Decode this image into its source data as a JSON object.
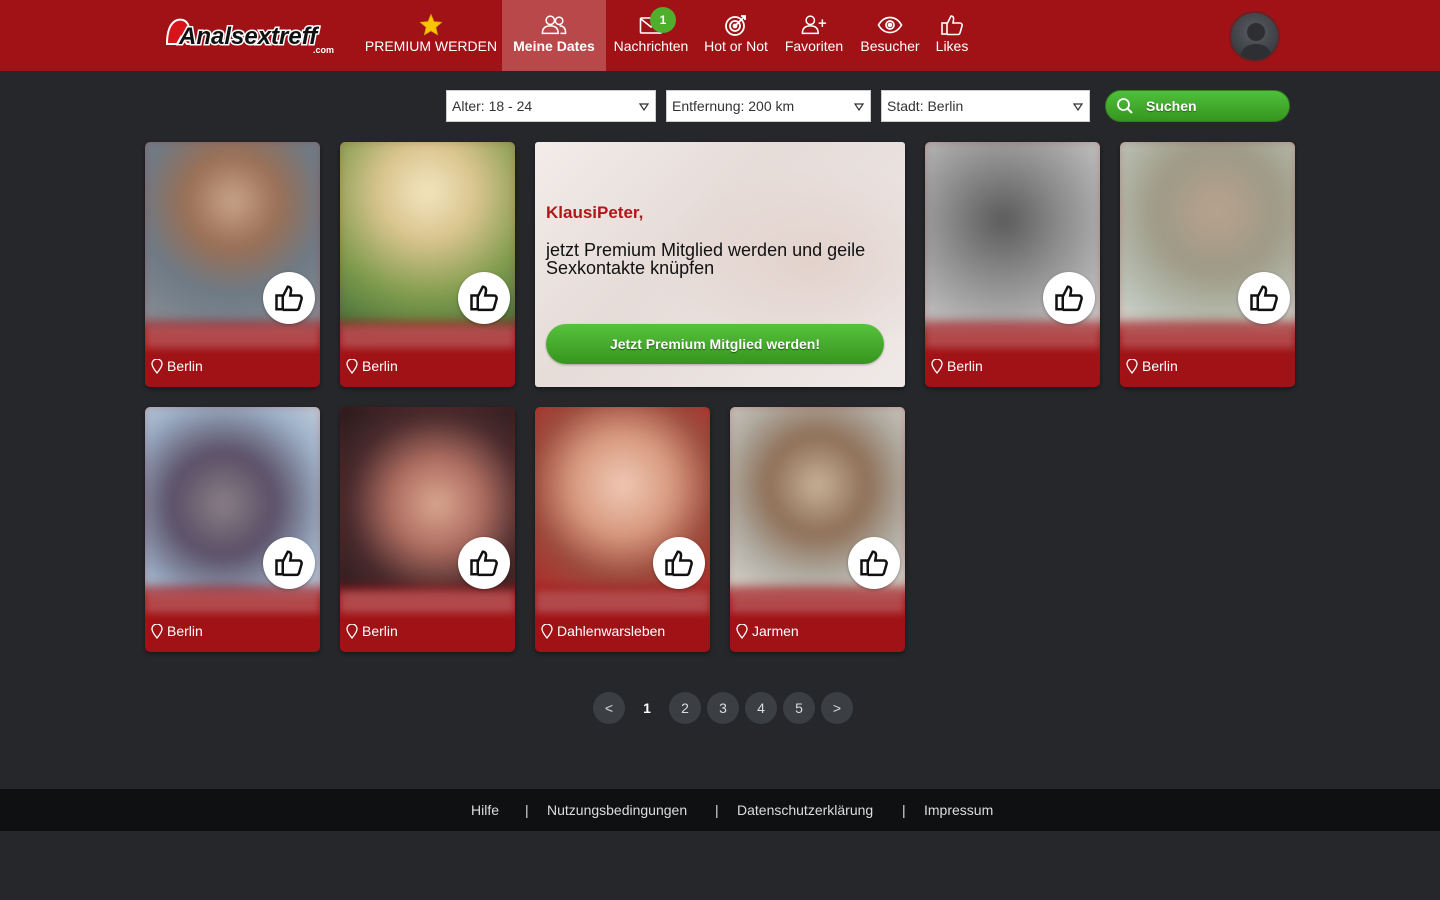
{
  "header": {
    "logo_text": "Analsextreff",
    "logo_suffix": ".com",
    "nav": [
      {
        "label": "PREMIUM WERDEN",
        "icon": "star-icon"
      },
      {
        "label": "Meine Dates",
        "icon": "users-icon"
      },
      {
        "label": "Nachrichten",
        "icon": "envelope-icon",
        "badge": "1"
      },
      {
        "label": "Hot or Not",
        "icon": "target-icon"
      },
      {
        "label": "Favoriten",
        "icon": "add-user-icon"
      },
      {
        "label": "Besucher",
        "icon": "eye-icon"
      },
      {
        "label": "Likes",
        "icon": "thumbs-up-icon"
      }
    ],
    "active_nav": "Meine Dates"
  },
  "filters": {
    "age": "Alter: 18 - 24",
    "distance": "Entfernung: 200 km",
    "city": "Stadt: Berlin",
    "search_label": "Suchen"
  },
  "cards": [
    {
      "city": "Berlin"
    },
    {
      "city": "Berlin"
    },
    {
      "city": "Berlin"
    },
    {
      "city": "Berlin"
    },
    {
      "city": "Berlin"
    },
    {
      "city": "Berlin"
    },
    {
      "city": "Dahlenwarsleben"
    },
    {
      "city": "Jarmen"
    }
  ],
  "promo": {
    "name": "KlausiPeter,",
    "text": "jetzt Premium Mitglied werden und geile Sexkontakte knüpfen",
    "button": "Jetzt Premium Mitglied werden!"
  },
  "pagination": {
    "prev": "<",
    "pages": [
      "1",
      "2",
      "3",
      "4",
      "5"
    ],
    "current": "1",
    "next": ">"
  },
  "footer": {
    "links": [
      "Hilfe",
      "Nutzungsbedingungen",
      "Datenschutzerklärung",
      "Impressum"
    ],
    "separator": "|"
  },
  "colors": {
    "header_bg": "#a01216",
    "page_bg": "#25272b",
    "accent_green": "#4fae2b",
    "footer_bg": "#0f1011"
  }
}
